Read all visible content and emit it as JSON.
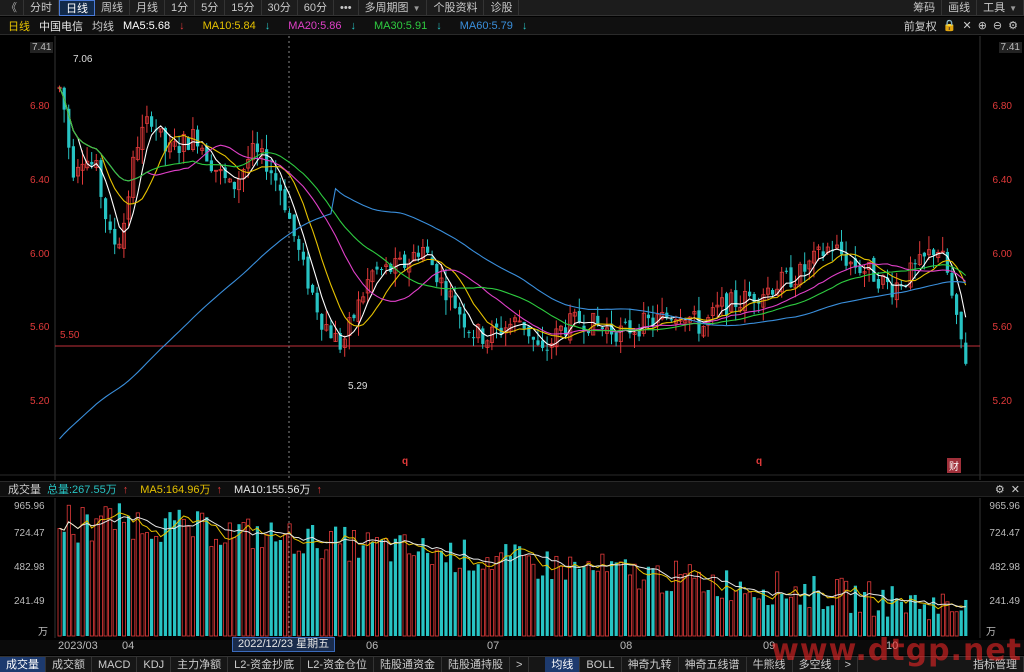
{
  "toolbar": {
    "back": "《",
    "tabs": [
      "分时",
      "日线",
      "周线",
      "月线",
      "1分",
      "5分",
      "15分",
      "30分",
      "60分",
      "•••",
      "多周期图",
      "个股资料",
      "诊股"
    ],
    "active_tab": "日线",
    "right": [
      "筹码",
      "画线",
      "工具"
    ]
  },
  "info": {
    "period": "日线",
    "stock": "中国电信",
    "ma_label": "均线",
    "ma5": "MA5:5.68",
    "ma10": "MA10:5.84",
    "ma20": "MA20:5.86",
    "ma30": "MA30:5.91",
    "ma60": "MA60:5.79",
    "fq": "前复权",
    "colors": {
      "ma5": "#ffffff",
      "ma10": "#e6c200",
      "ma20": "#e040c8",
      "ma30": "#2ecc40",
      "ma60": "#3a8fdc"
    }
  },
  "price_axis": {
    "ticks": [
      "7.41",
      "6.80",
      "6.40",
      "6.00",
      "5.60",
      "5.20"
    ],
    "ref_line": "5.50",
    "high_marker": "7.06",
    "low_marker": "5.29"
  },
  "markers": {
    "q1": "q",
    "q2": "q",
    "fin": "财"
  },
  "volume": {
    "title": "成交量",
    "total": "总量:267.55万",
    "ma5": "MA5:164.96万",
    "ma10": "MA10:155.56万",
    "ticks": [
      "965.96",
      "724.47",
      "482.98",
      "241.49"
    ],
    "unit": "万"
  },
  "dates": {
    "labels": [
      "2023/03",
      "04",
      "06",
      "07",
      "08",
      "09",
      "10"
    ],
    "cursor": "2022/12/23 星期五"
  },
  "bottom_tabs": {
    "left": [
      "成交量",
      "成交额",
      "MACD",
      "KDJ",
      "主力净额",
      "L2-资金抄底",
      "L2-资金仓位",
      "陆股通资金",
      "陆股通持股"
    ],
    "active_left": "成交量",
    "right": [
      "均线",
      "BOLL",
      "神奇九转",
      "神奇五线谱",
      "牛熊线",
      "多空线"
    ],
    "active_right": "均线",
    "manage": "指标管理"
  },
  "watermark": "www.dtgp.net",
  "colors": {
    "up": "#e23a3a",
    "down": "#27c3c3",
    "accent": "#3b6bbd"
  }
}
